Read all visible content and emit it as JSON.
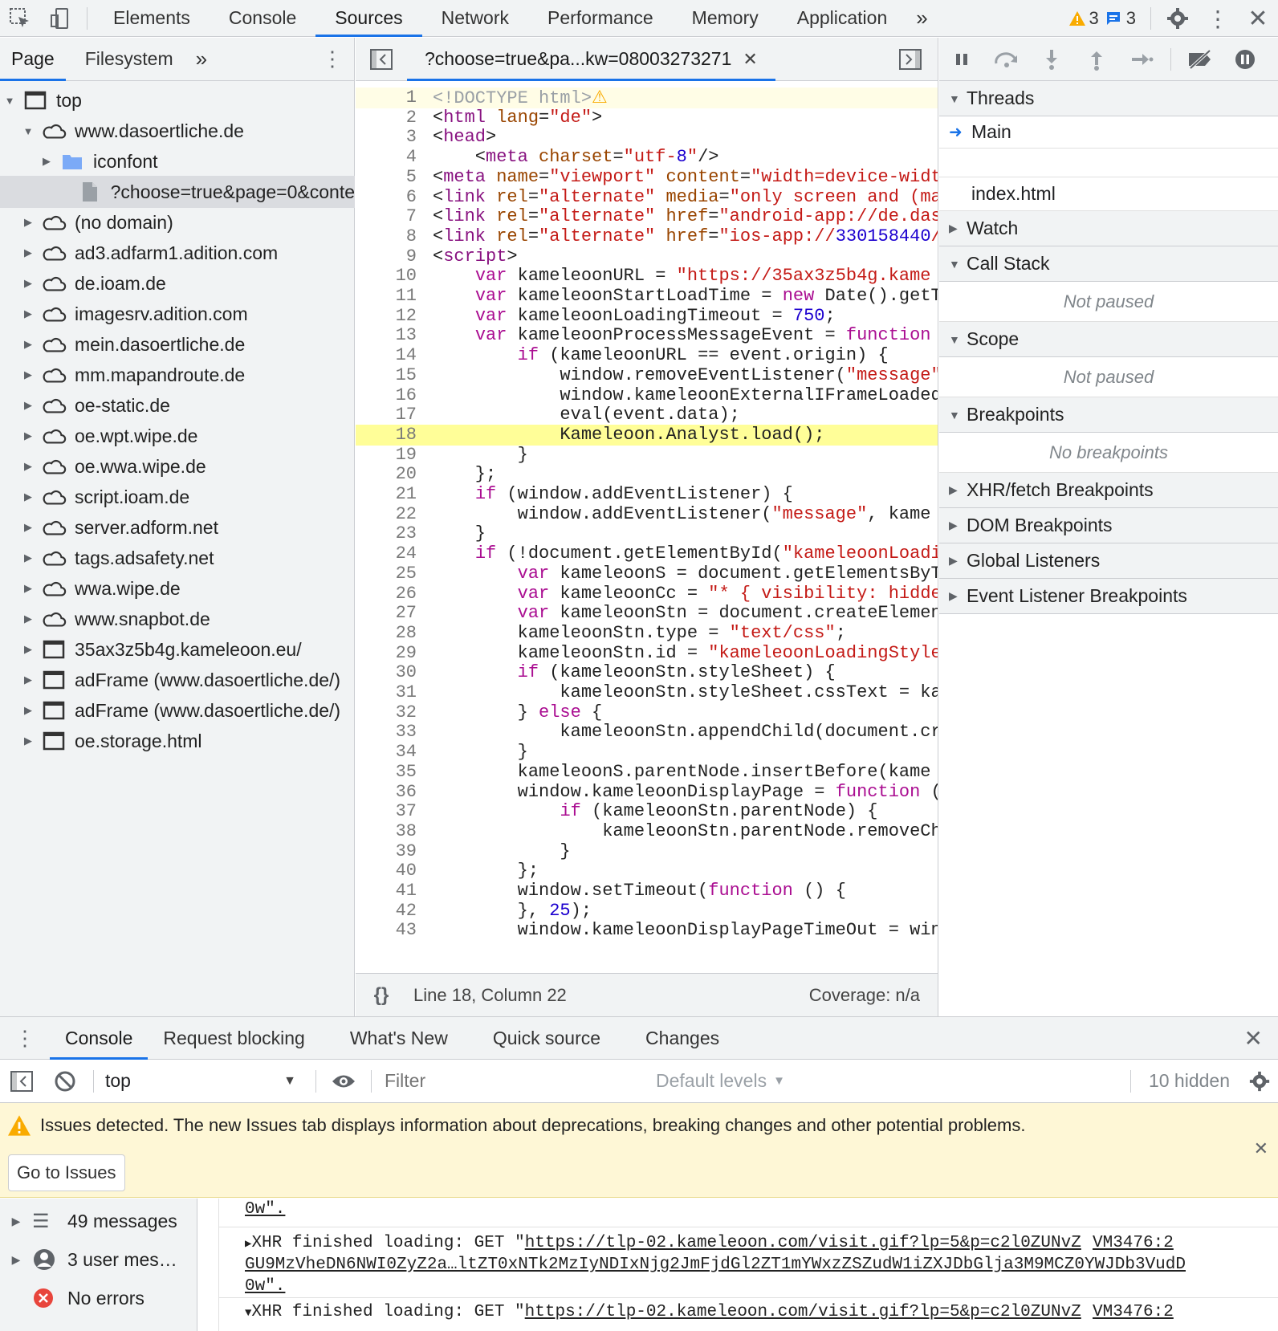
{
  "toolbar": {
    "tabs": [
      "Elements",
      "Console",
      "Sources",
      "Network",
      "Performance",
      "Memory",
      "Application"
    ],
    "warning_count": "3",
    "message_count": "3"
  },
  "left": {
    "tabs": [
      "Page",
      "Filesystem"
    ],
    "tree": [
      {
        "label": "top",
        "icon": "frame-icon",
        "indent": 0,
        "open": true
      },
      {
        "label": "www.dasoertliche.de",
        "icon": "cloud-icon",
        "indent": 1,
        "open": true
      },
      {
        "label": "iconfont",
        "icon": "folder-icon",
        "indent": 2,
        "open": false
      },
      {
        "label": "?choose=true&page=0&conte",
        "icon": "file-icon",
        "indent": 3,
        "leaf": true,
        "selected": true
      },
      {
        "label": "(no domain)",
        "icon": "cloud-icon",
        "indent": 1
      },
      {
        "label": "ad3.adfarm1.adition.com",
        "icon": "cloud-icon",
        "indent": 1
      },
      {
        "label": "de.ioam.de",
        "icon": "cloud-icon",
        "indent": 1
      },
      {
        "label": "imagesrv.adition.com",
        "icon": "cloud-icon",
        "indent": 1
      },
      {
        "label": "mein.dasoertliche.de",
        "icon": "cloud-icon",
        "indent": 1
      },
      {
        "label": "mm.mapandroute.de",
        "icon": "cloud-icon",
        "indent": 1
      },
      {
        "label": "oe-static.de",
        "icon": "cloud-icon",
        "indent": 1
      },
      {
        "label": "oe.wpt.wipe.de",
        "icon": "cloud-icon",
        "indent": 1
      },
      {
        "label": "oe.wwa.wipe.de",
        "icon": "cloud-icon",
        "indent": 1
      },
      {
        "label": "script.ioam.de",
        "icon": "cloud-icon",
        "indent": 1
      },
      {
        "label": "server.adform.net",
        "icon": "cloud-icon",
        "indent": 1
      },
      {
        "label": "tags.adsafety.net",
        "icon": "cloud-icon",
        "indent": 1
      },
      {
        "label": "wwa.wipe.de",
        "icon": "cloud-icon",
        "indent": 1
      },
      {
        "label": "www.snapbot.de",
        "icon": "cloud-icon",
        "indent": 1
      },
      {
        "label": "35ax3z5b4g.kameleoon.eu/",
        "icon": "frame-icon",
        "indent": 1
      },
      {
        "label": "adFrame (www.dasoertliche.de/)",
        "icon": "frame-icon",
        "indent": 1
      },
      {
        "label": "adFrame (www.dasoertliche.de/)",
        "icon": "frame-icon",
        "indent": 1
      },
      {
        "label": "oe.storage.html",
        "icon": "frame-icon",
        "indent": 1
      }
    ]
  },
  "editor": {
    "file_tab": "?choose=true&pa...kw=08003273271",
    "highlight_line": 18,
    "lines": [
      "<!DOCTYPE html>",
      "<html lang=\"de\">",
      "<head>",
      "    <meta charset=\"utf-8\"/>",
      "<meta name=\"viewport\" content=\"width=device-widt",
      "<link rel=\"alternate\" media=\"only screen and (ma",
      "<link rel=\"alternate\" href=\"android-app://de.das",
      "<link rel=\"alternate\" href=\"ios-app://330158440/",
      "<script>",
      "    var kameleoonURL = \"https://35ax3z5b4g.kame",
      "    var kameleoonStartLoadTime = new Date().getT",
      "    var kameleoonLoadingTimeout = 750;",
      "    var kameleoonProcessMessageEvent = function ",
      "        if (kameleoonURL == event.origin) {",
      "            window.removeEventListener(\"message\"",
      "            window.kameleoonExternalIFrameLoaded",
      "            eval(event.data);",
      "            Kameleoon.Analyst.load();",
      "        }",
      "    };",
      "    if (window.addEventListener) {",
      "        window.addEventListener(\"message\", kame",
      "    }",
      "    if (!document.getElementById(\"kameleoonLoadi",
      "        var kameleoonS = document.getElementsByT",
      "        var kameleoonCc = \"* { visibility: hidde",
      "        var kameleoonStn = document.createElemen",
      "        kameleoonStn.type = \"text/css\";",
      "        kameleoonStn.id = \"kameleoonLoadingStyle",
      "        if (kameleoonStn.styleSheet) {",
      "            kameleoonStn.styleSheet.cssText = ka",
      "        } else {",
      "            kameleoonStn.appendChild(document.cr",
      "        }",
      "        kameleoonS.parentNode.insertBefore(kame",
      "        window.kameleoonDisplayPage = function (",
      "            if (kameleoonStn.parentNode) {",
      "                kameleoonStn.parentNode.removeCh",
      "            }",
      "        };",
      "        window.setTimeout(function () {",
      "        }, 25);",
      "        window.kameleoonDisplayPageTimeOut = win"
    ],
    "status_position": "Line 18, Column 22",
    "coverage": "Coverage: n/a"
  },
  "debugger": {
    "sections": [
      {
        "title": "Threads",
        "open": true
      },
      {
        "title": "Watch",
        "open": false
      },
      {
        "title": "Call Stack",
        "open": true,
        "body": "Not paused"
      },
      {
        "title": "Scope",
        "open": true,
        "body": "Not paused"
      },
      {
        "title": "Breakpoints",
        "open": true,
        "body": "No breakpoints"
      },
      {
        "title": "XHR/fetch Breakpoints",
        "open": false
      },
      {
        "title": "DOM Breakpoints",
        "open": false
      },
      {
        "title": "Global Listeners",
        "open": false
      },
      {
        "title": "Event Listener Breakpoints",
        "open": false
      }
    ],
    "thread_main": "Main",
    "thread_file": "index.html"
  },
  "drawer": {
    "tabs": [
      "Console",
      "Request blocking",
      "What's New",
      "Quick source",
      "Changes"
    ],
    "context": "top",
    "filter_placeholder": "Filter",
    "levels": "Default levels",
    "hidden": "10 hidden"
  },
  "issues": {
    "text": "Issues detected. The new Issues tab displays information about deprecations, breaking changes and other potential problems.",
    "button": "Go to Issues"
  },
  "console_sidebar": [
    {
      "label": "49 messages",
      "icon": "list-icon"
    },
    {
      "label": "3 user mes…",
      "icon": "user-icon"
    },
    {
      "label": "No errors",
      "icon": "error-icon"
    }
  ],
  "logs": {
    "line1": "0w\".",
    "xhr_prefix": "XHR finished loading: GET \"",
    "url1": "https://tlp-02.kameleoon.com/visit.gif?lp=5&p=c2l0ZUNvZ",
    "src1": "VM3476:2",
    "url1b": "GU9MzVheDN6NWI0ZyZ2a…ltZT0xNTk2MzIyNDIxNjg2JmFjdGl2ZT1mYWxzZSZudW1iZXJDbGlja3M9MCZ0YWJDb3VudD",
    "line_end": "0w\".",
    "url2": "https://tlp-02.kameleoon.com/visit.gif?lp=5&p=c2l0ZUNvZ",
    "src2": "VM3476:2"
  },
  "colors": {
    "accent": "#1a73e8",
    "highlight": "#fffe98",
    "warning": "#f9ab00",
    "issues_bg": "#fef7d6"
  }
}
